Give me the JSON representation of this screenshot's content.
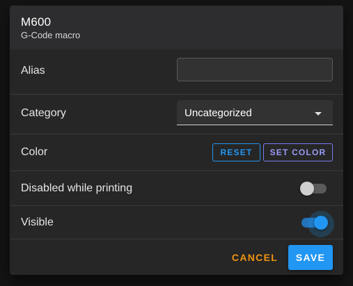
{
  "dialog": {
    "title": "M600",
    "subtitle": "G-Code macro"
  },
  "fields": {
    "alias": {
      "label": "Alias",
      "value": "",
      "placeholder": ""
    },
    "category": {
      "label": "Category",
      "selected": "Uncategorized",
      "icon": "caret-down-icon"
    },
    "color": {
      "label": "Color",
      "reset_label": "RESET",
      "set_color_label": "SET COLOR"
    },
    "disabled_while_printing": {
      "label": "Disabled while printing",
      "on": false
    },
    "visible": {
      "label": "Visible",
      "on": true
    }
  },
  "actions": {
    "cancel_label": "CANCEL",
    "save_label": "SAVE"
  },
  "colors": {
    "primary": "#2196f3",
    "accent": "#f0930f",
    "secondary": "#7c7cf0",
    "surface": "#262626",
    "header": "#2d2d2f"
  }
}
